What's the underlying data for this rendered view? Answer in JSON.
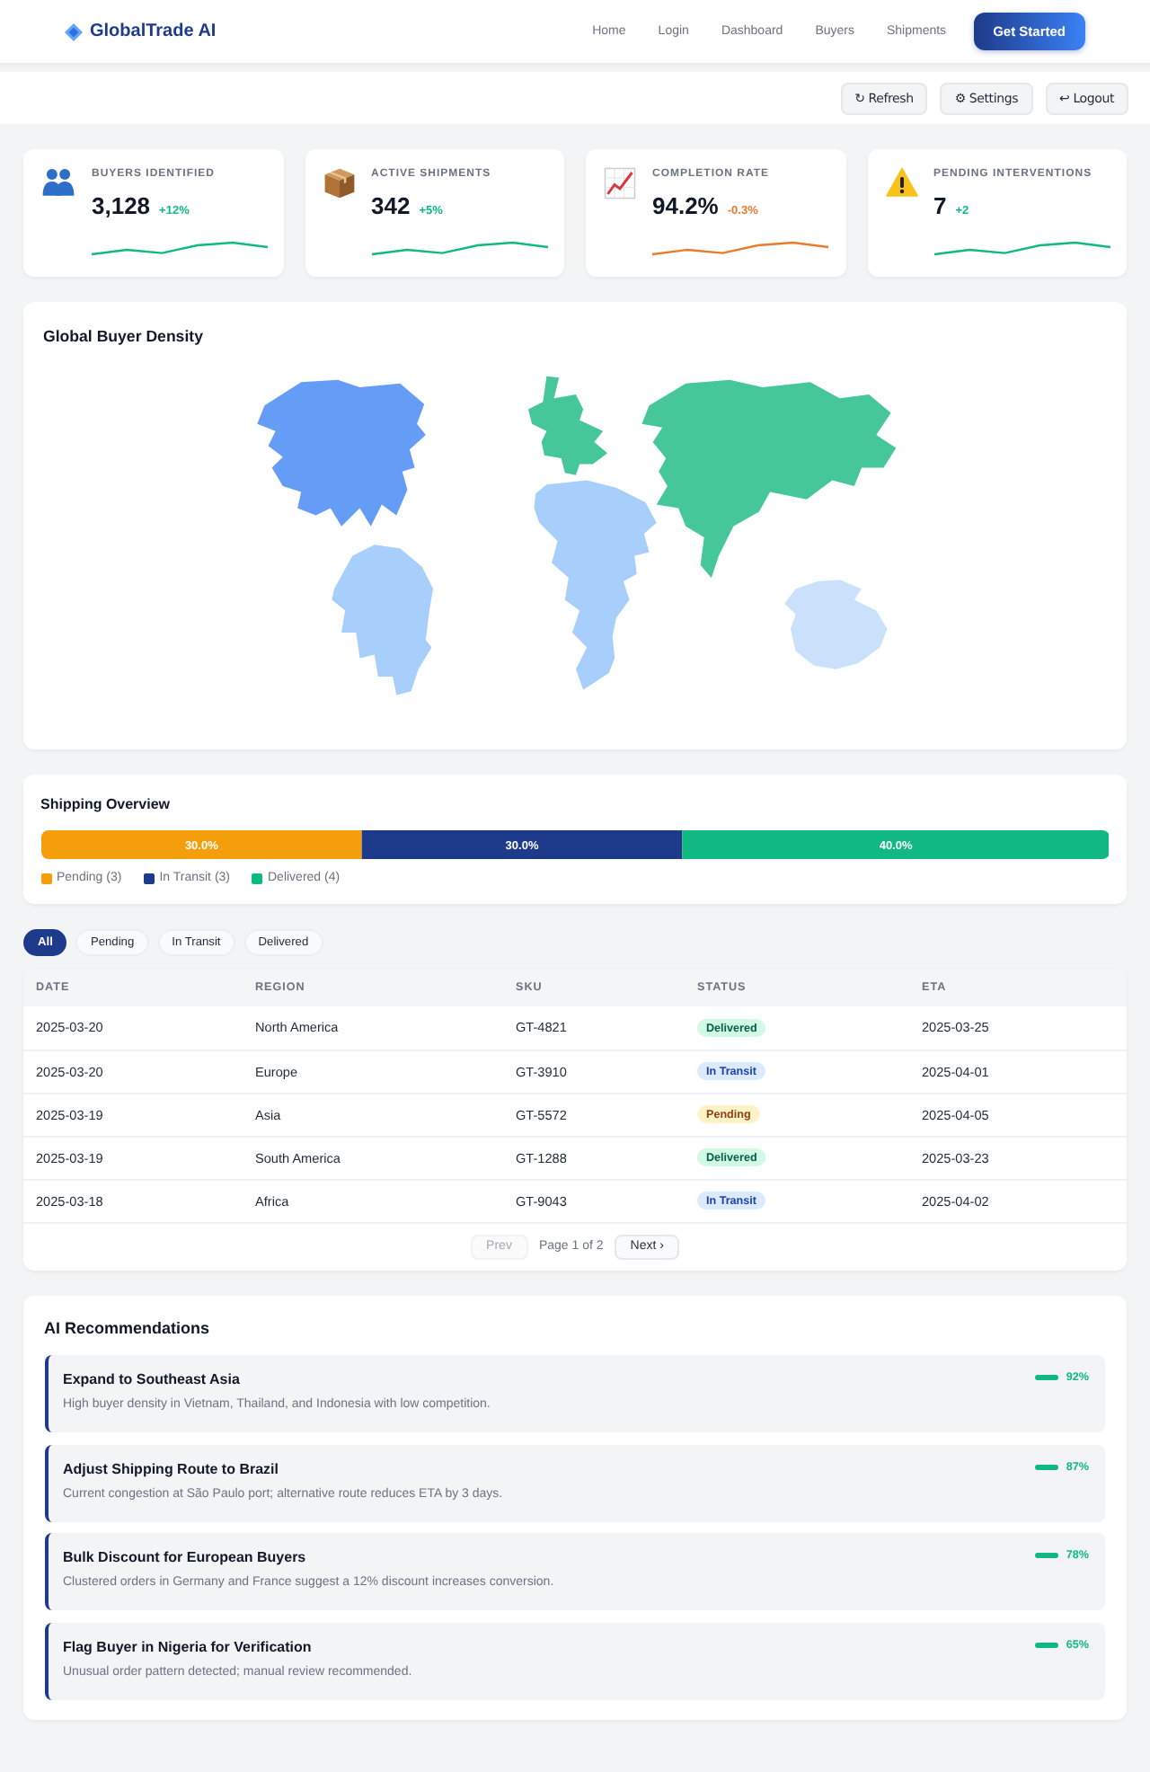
{
  "header": {
    "brand": "GlobalTrade AI",
    "nav": [
      "Home",
      "Login",
      "Dashboard",
      "Buyers",
      "Shipments"
    ],
    "cta": "Get Started"
  },
  "toolbar": {
    "buttons": [
      "↻ Refresh",
      "⚙ Settings",
      "↩ Logout"
    ]
  },
  "kpis": [
    {
      "label": "BUYERS IDENTIFIED",
      "value": "3,128",
      "delta": "+12%",
      "negative": false
    },
    {
      "label": "ACTIVE SHIPMENTS",
      "value": "342",
      "delta": "+5%",
      "negative": false
    },
    {
      "label": "COMPLETION RATE",
      "value": "94.2%",
      "delta": "-0.3%",
      "negative": true
    },
    {
      "label": "PENDING INTERVENTIONS",
      "value": "7",
      "delta": "+2",
      "negative": false
    }
  ],
  "density_map": {
    "title": "Global Buyer Density",
    "regions": [
      {
        "color": "#649cf6"
      },
      {
        "color": "#a8cffb"
      },
      {
        "color": "#45c79a"
      },
      {
        "color": "#a8cffb"
      },
      {
        "color": "#45c79a"
      },
      {
        "color": "#cae0fb"
      }
    ]
  },
  "shipping_overview": {
    "title": "Shipping Overview",
    "chart_data": {
      "type": "bar",
      "orientation": "horizontal",
      "stacked": true,
      "series": [
        {
          "name": "Pending (3)",
          "color": "#f59e0b",
          "values": [
            30
          ],
          "value_labels": [
            "30.0%"
          ]
        },
        {
          "name": "In Transit (3)",
          "color": "#1e3a8a",
          "values": [
            30
          ],
          "value_labels": [
            "30.0%"
          ]
        },
        {
          "name": "Delivered (4)",
          "color": "#10b981",
          "values": [
            40
          ],
          "value_labels": [
            "40.0%"
          ]
        }
      ],
      "data_labels": true
    }
  },
  "filters": [
    {
      "label": "All",
      "selected": true
    },
    {
      "label": "Pending",
      "selected": false
    },
    {
      "label": "In Transit",
      "selected": false
    },
    {
      "label": "Delivered",
      "selected": false
    }
  ],
  "shipments_table": {
    "columns": [
      "DATE",
      "REGION",
      "SKU",
      "STATUS",
      "ETA"
    ],
    "rows": [
      {
        "date": "2025-03-20",
        "region": "North America",
        "sku": "GT-4821",
        "status": {
          "label": "Delivered",
          "kind": "delivered"
        },
        "eta": "2025-03-25"
      },
      {
        "date": "2025-03-20",
        "region": "Europe",
        "sku": "GT-3910",
        "status": {
          "label": "In Transit",
          "kind": "transit"
        },
        "eta": "2025-04-01"
      },
      {
        "date": "2025-03-19",
        "region": "Asia",
        "sku": "GT-5572",
        "status": {
          "label": "Pending",
          "kind": "pending"
        },
        "eta": "2025-04-05"
      },
      {
        "date": "2025-03-19",
        "region": "South America",
        "sku": "GT-1288",
        "status": {
          "label": "Delivered",
          "kind": "delivered"
        },
        "eta": "2025-03-23"
      },
      {
        "date": "2025-03-18",
        "region": "Africa",
        "sku": "GT-9043",
        "status": {
          "label": "In Transit",
          "kind": "transit"
        },
        "eta": "2025-04-02"
      }
    ],
    "pagination": {
      "prev": {
        "label": "Prev",
        "disabled": true
      },
      "page": "Page 1 of 2",
      "next": {
        "label": "Next ›",
        "disabled": false
      }
    }
  },
  "recommendations": {
    "title": "AI Recommendations",
    "items": [
      {
        "title": "Expand to Southeast Asia",
        "description": "High buyer density in Vietnam, Thailand, and Indonesia with low competition.",
        "confidence": "92%"
      },
      {
        "title": "Adjust Shipping Route to Brazil",
        "description": "Current congestion at São Paulo port; alternative route reduces ETA by 3 days.",
        "confidence": "87%"
      },
      {
        "title": "Bulk Discount for European Buyers",
        "description": "Clustered orders in Germany and France suggest a 12% discount increases conversion.",
        "confidence": "78%"
      },
      {
        "title": "Flag Buyer in Nigeria for Verification",
        "description": "Unusual order pattern detected; manual review recommended.",
        "confidence": "65%"
      }
    ]
  }
}
